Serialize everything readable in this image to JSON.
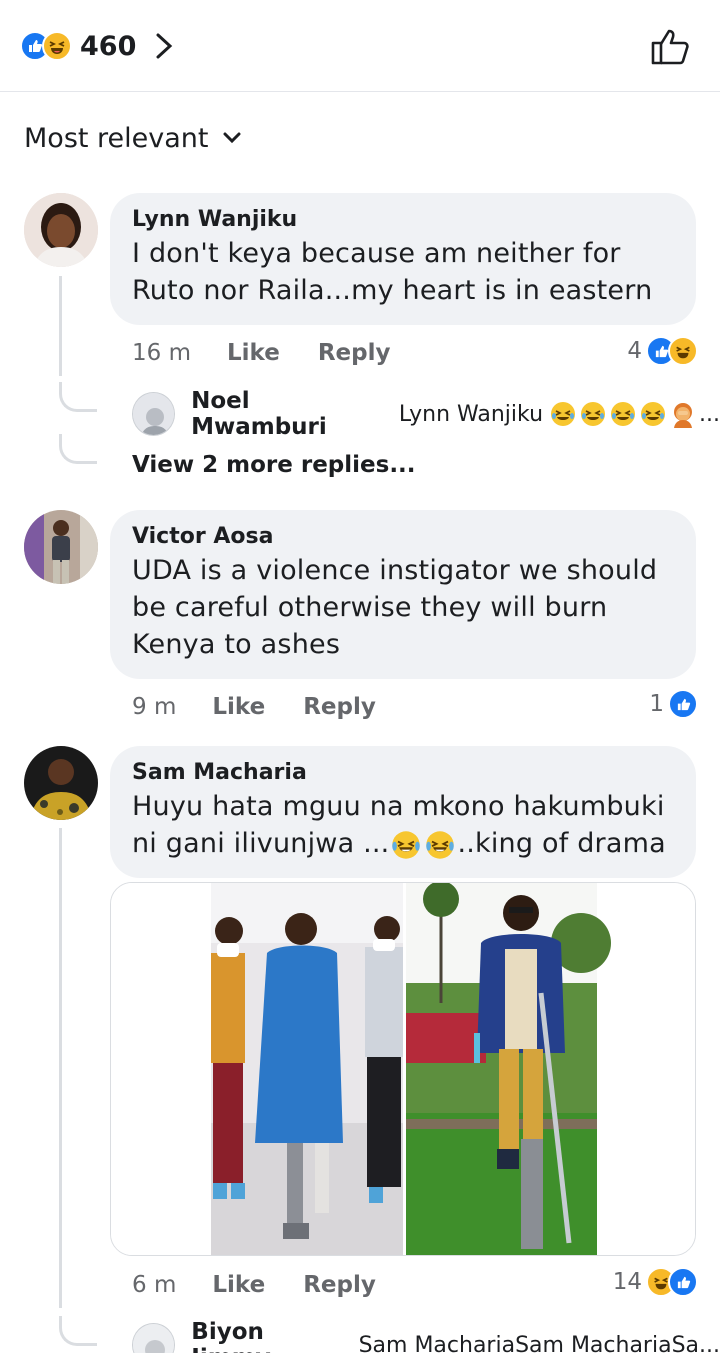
{
  "header": {
    "reaction_count": "460",
    "reaction_icons": [
      "like-icon",
      "haha-icon"
    ],
    "like_button_icon": "thumbs-up-outline-icon"
  },
  "sort": {
    "label": "Most relevant"
  },
  "colors": {
    "like_blue": "#1877f2",
    "haha_yellow": "#f7b928",
    "bubble_bg": "#f0f2f5",
    "meta_gray": "#65676b"
  },
  "comments": [
    {
      "author": "Lynn Wanjiku",
      "text": "I don't keya because am neither for Ruto nor Raila...my heart is in eastern",
      "time": "16 m",
      "like_label": "Like",
      "reply_label": "Reply",
      "reaction_count": "4",
      "reactions": [
        "like-icon",
        "haha-icon"
      ],
      "reply_preview": {
        "author": "Noel Mwamburi",
        "text": "Lynn Wanjiku",
        "trailing": "..."
      },
      "view_more": "View 2 more replies..."
    },
    {
      "author": "Victor Aosa",
      "text": "UDA is a violence instigator we should be careful otherwise they will burn Kenya to ashes",
      "time": "9 m",
      "like_label": "Like",
      "reply_label": "Reply",
      "reaction_count": "1",
      "reactions": [
        "like-icon"
      ]
    },
    {
      "author": "Sam Macharia",
      "text_before": "Huyu hata mguu na mkono hakumbuki ni gani ilivunjwa ...",
      "text_after": "..king of drama",
      "time": "6 m",
      "like_label": "Like",
      "reply_label": "Reply",
      "reaction_count": "14",
      "reactions": [
        "haha-icon",
        "like-icon"
      ],
      "reply_preview": {
        "author": "Biyon Jimmy",
        "text": "Sam MachariaSam MachariaSa..."
      }
    }
  ]
}
